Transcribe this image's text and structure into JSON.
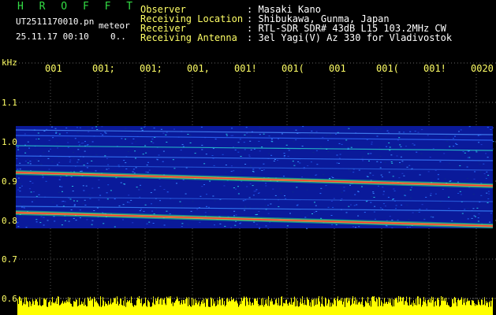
{
  "header": {
    "program": "H R O F F T",
    "filename": "UT2511170010.pn",
    "mode": "meteor",
    "datetime": "25.11.17 00:10",
    "zero": "0..",
    "fields": [
      {
        "label": "Observer",
        "value": ": Masaki Kano"
      },
      {
        "label": "Receiving Location",
        "value": ": Shibukawa, Gunma, Japan"
      },
      {
        "label": "Receiver",
        "value": ": RTL-SDR SDR# 43dB L15 103.2MHz CW"
      },
      {
        "label": "Receiving Antenna",
        "value": ": 3el Yagi(V) Az 330 for Vladivostok"
      }
    ]
  },
  "time_axis": {
    "ticks": [
      "001",
      "001;",
      "001;",
      "001,",
      "001!",
      "001(",
      "001",
      "001(",
      "001!",
      "0020"
    ]
  },
  "freq_axis": {
    "unit": "kHz",
    "ticks": [
      "1.1",
      "1.0",
      "0.9",
      "0.8",
      "0.7",
      "0.6"
    ]
  },
  "colors": {
    "background": "#000000",
    "label_text": "#ffff66",
    "program_title": "#33dd44",
    "noise_bar": "#ffff00",
    "spectrogram_base": "#0a1a9a",
    "signal_line": "#ff3030"
  }
}
